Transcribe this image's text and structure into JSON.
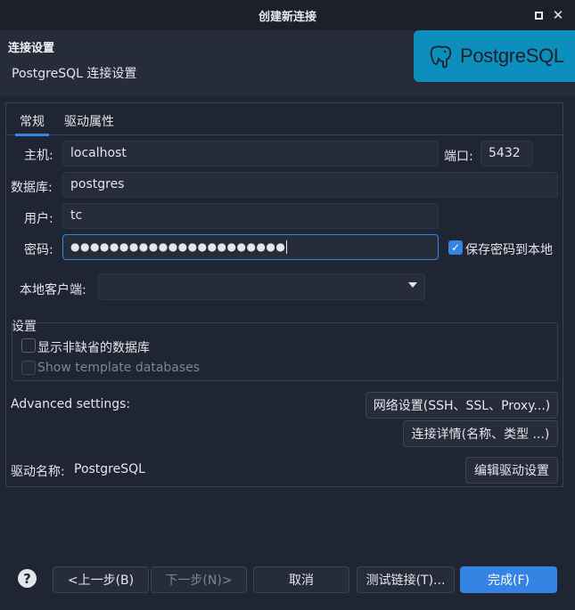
{
  "window": {
    "title": "创建新连接"
  },
  "header": {
    "title": "连接设置",
    "subtitle": "PostgreSQL 连接设置",
    "logo_text": "PostgreSQL",
    "logo_color": "#0d8fbd"
  },
  "tabs": [
    {
      "label": "常规",
      "active": true
    },
    {
      "label": "驱动属性",
      "active": false
    }
  ],
  "form": {
    "host_label": "主机:",
    "host_value": "localhost",
    "port_label": "端口:",
    "port_value": "5432",
    "database_label": "数据库:",
    "database_value": "postgres",
    "user_label": "用户:",
    "user_value": "tc",
    "password_label": "密码:",
    "password_value": "●●●●●●●●●●●●●●●●●●●●●●",
    "save_password_label": "保存密码到本地",
    "save_password_checked": true,
    "local_client_label": "本地客户端:",
    "local_client_value": ""
  },
  "settings": {
    "group_label": "设置",
    "show_non_default_db": "显示非缺省的数据库",
    "show_templates": "Show template databases"
  },
  "advanced": {
    "label": "Advanced settings:",
    "network_button": "网络设置(SSH、SSL、Proxy...)",
    "details_button": "连接详情(名称、类型 ...)"
  },
  "driver": {
    "label": "驱动名称:",
    "value": "PostgreSQL",
    "edit_button": "编辑驱动设置"
  },
  "footer": {
    "back": "<上一步(B)",
    "next": "下一步(N)>",
    "cancel": "取消",
    "test": "测试链接(T)...",
    "finish": "完成(F)"
  },
  "colors": {
    "accent": "#3584e4",
    "background": "#1f2532"
  }
}
